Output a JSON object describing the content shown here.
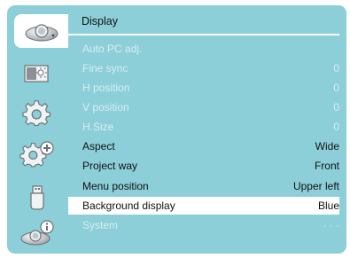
{
  "colors": {
    "panel": "#8ccfd8",
    "disabled_text": "#d8eef1",
    "selected_bg": "#ffffff",
    "text": "#111111"
  },
  "sidebar": {
    "tabs": [
      {
        "icon": "projector-icon",
        "active": true
      },
      {
        "icon": "image-adjust-icon",
        "active": false
      },
      {
        "icon": "gear-icon",
        "active": false
      },
      {
        "icon": "gear-plus-icon",
        "active": false
      },
      {
        "icon": "usb-icon",
        "active": false
      },
      {
        "icon": "projector-info-icon",
        "active": false
      }
    ]
  },
  "menu": {
    "title": "Display",
    "items": [
      {
        "label": "Auto PC adj.",
        "value": "",
        "state": "disabled"
      },
      {
        "label": "Fine sync",
        "value": "0",
        "state": "disabled"
      },
      {
        "label": "H position",
        "value": "0",
        "state": "disabled"
      },
      {
        "label": "V position",
        "value": "0",
        "state": "disabled"
      },
      {
        "label": "H.Size",
        "value": "0",
        "state": "disabled"
      },
      {
        "label": "Aspect",
        "value": "Wide",
        "state": "enabled"
      },
      {
        "label": "Project way",
        "value": "Front",
        "state": "enabled"
      },
      {
        "label": "Menu position",
        "value": "Upper left",
        "state": "enabled"
      },
      {
        "label": "Background display",
        "value": "Blue",
        "state": "selected"
      },
      {
        "label": "System",
        "value": "· · ·",
        "state": "disabled"
      }
    ]
  }
}
